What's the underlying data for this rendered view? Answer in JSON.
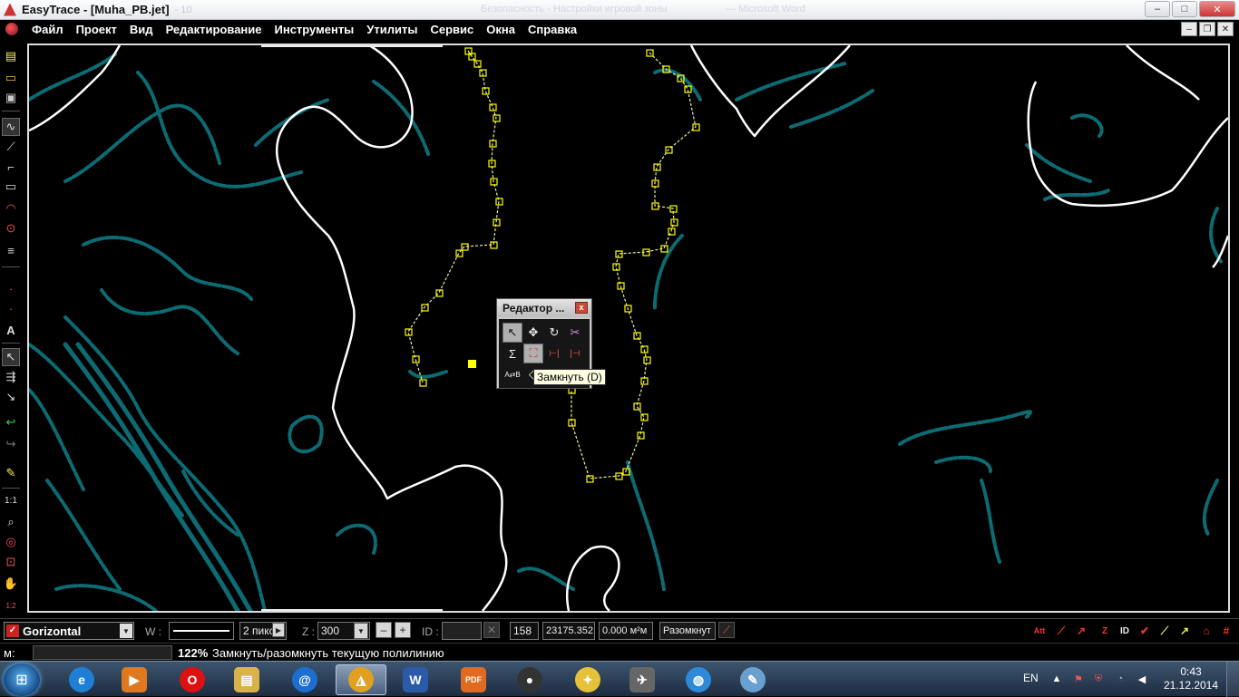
{
  "window": {
    "title": "EasyTrace - [Muha_PB.jet]",
    "ghost_title_left": "- 10",
    "ghost_title_mid": "Безопасность - Настройки игровой зоны",
    "ghost_title_right": "— Microsoft Word",
    "controls": {
      "minimize": "–",
      "maximize": "□",
      "close": "✕"
    }
  },
  "menu": {
    "items": [
      "Файл",
      "Проект",
      "Вид",
      "Редактирование",
      "Инструменты",
      "Утилиты",
      "Сервис",
      "Окна",
      "Справка"
    ],
    "mdi_controls": [
      "–",
      "❐",
      "✕"
    ]
  },
  "palette": {
    "title": "Редактор ...",
    "close": "x",
    "buttons": [
      {
        "name": "select-arrow-icon",
        "glyph": "↖",
        "active": true
      },
      {
        "name": "move-icon",
        "glyph": "✥"
      },
      {
        "name": "rotate-icon",
        "glyph": "↻"
      },
      {
        "name": "scissors-icon",
        "glyph": "✂"
      },
      {
        "name": "sum-icon",
        "glyph": "Σ"
      },
      {
        "name": "close-polyline-icon",
        "glyph": "⛶",
        "active": true
      },
      {
        "name": "split-icon",
        "glyph": "⊢|"
      },
      {
        "name": "join-icon",
        "glyph": "|⊣"
      },
      {
        "name": "ab-icon",
        "glyph": "A⇄B"
      },
      {
        "name": "node-icon",
        "glyph": "◇"
      },
      {
        "name": "extra-icon-1",
        "glyph": ""
      },
      {
        "name": "extra-icon-2",
        "glyph": ""
      }
    ]
  },
  "tooltip": "Замкнуть (D)",
  "bottom_toolbar": {
    "layer": "Gorizontal",
    "w_label": "W :",
    "width_value": "2 пикс",
    "z_label": "Z :",
    "z_value": "300",
    "minus": "–",
    "plus": "+",
    "id_label": "ID :",
    "id_value": "",
    "count": "158",
    "coordinate": "23175.352",
    "area": "0.000 м²м",
    "toggle_button": "Разомкнут",
    "right_icons": [
      "Att",
      "ID",
      "Z"
    ]
  },
  "status": {
    "prefix": "м:",
    "zoom": "122%",
    "message": "Замкнуть/разомкнуть текущую полилинию"
  },
  "taskbar": {
    "lang": "EN",
    "time": "0:43",
    "date": "21.12.2014",
    "apps": [
      {
        "name": "ie",
        "label": "e",
        "color": "#1f7fd6"
      },
      {
        "name": "media-player",
        "label": "▶",
        "color": "#e07820"
      },
      {
        "name": "opera",
        "label": "O",
        "color": "#d11"
      },
      {
        "name": "explorer",
        "label": "▤",
        "color": "#d9b24a"
      },
      {
        "name": "mail",
        "label": "@",
        "color": "#1c6fd0"
      },
      {
        "name": "easytrace",
        "label": "◮",
        "color": "#e0a020",
        "active": true
      },
      {
        "name": "word",
        "label": "W",
        "color": "#2a5aa8"
      },
      {
        "name": "pdf",
        "label": "PDF",
        "color": "#e06a20"
      },
      {
        "name": "app-dark",
        "label": "●",
        "color": "#333"
      },
      {
        "name": "idea",
        "label": "✦",
        "color": "#e5c23a"
      },
      {
        "name": "paper-plane",
        "label": "✈",
        "color": "#666"
      },
      {
        "name": "globe",
        "label": "◍",
        "color": "#2d8ad8"
      },
      {
        "name": "paint",
        "label": "✎",
        "color": "#6aa0d0"
      }
    ]
  },
  "colors": {
    "map_background": "#000000",
    "contour_white": "#ffffff",
    "contour_teal": "#0d6b73",
    "vertex_yellow": "#ffff00"
  }
}
